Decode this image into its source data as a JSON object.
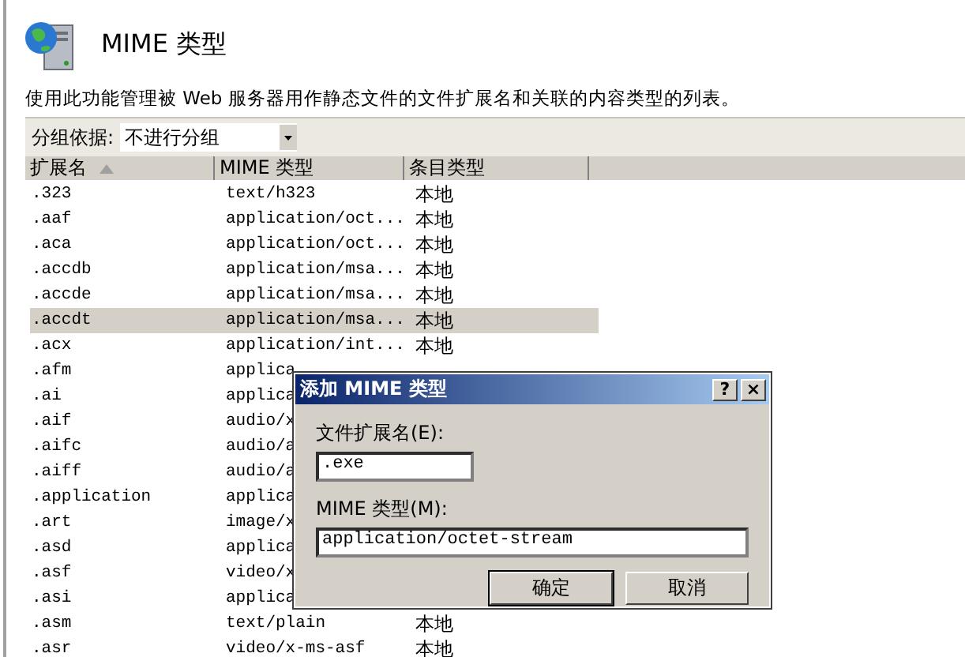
{
  "header": {
    "title": "MIME 类型",
    "description": "使用此功能管理被 Web 服务器用作静态文件的文件扩展名和关联的内容类型的列表。"
  },
  "group_by": {
    "label": "分组依据:",
    "value": "不进行分组"
  },
  "table": {
    "columns": [
      {
        "label": "扩展名",
        "sorted": true
      },
      {
        "label": "MIME 类型",
        "sorted": false
      },
      {
        "label": "条目类型",
        "sorted": false
      }
    ],
    "rows": [
      {
        "extension": ".323",
        "mime": "text/h323",
        "type": "本地",
        "selected": false
      },
      {
        "extension": ".aaf",
        "mime": "application/oct...",
        "type": "本地",
        "selected": false
      },
      {
        "extension": ".aca",
        "mime": "application/oct...",
        "type": "本地",
        "selected": false
      },
      {
        "extension": ".accdb",
        "mime": "application/msa...",
        "type": "本地",
        "selected": false
      },
      {
        "extension": ".accde",
        "mime": "application/msa...",
        "type": "本地",
        "selected": false
      },
      {
        "extension": ".accdt",
        "mime": "application/msa...",
        "type": "本地",
        "selected": true
      },
      {
        "extension": ".acx",
        "mime": "application/int...",
        "type": "本地",
        "selected": false
      },
      {
        "extension": ".afm",
        "mime": "applica",
        "selected": false
      },
      {
        "extension": ".ai",
        "mime": "applica",
        "selected": false
      },
      {
        "extension": ".aif",
        "mime": "audio/x",
        "selected": false
      },
      {
        "extension": ".aifc",
        "mime": "audio/a",
        "selected": false
      },
      {
        "extension": ".aiff",
        "mime": "audio/a",
        "selected": false
      },
      {
        "extension": ".application",
        "mime": "applica",
        "selected": false
      },
      {
        "extension": ".art",
        "mime": "image/x",
        "selected": false
      },
      {
        "extension": ".asd",
        "mime": "applica",
        "selected": false
      },
      {
        "extension": ".asf",
        "mime": "video/x",
        "selected": false
      },
      {
        "extension": ".asi",
        "mime": "applica",
        "selected": false
      },
      {
        "extension": ".asm",
        "mime": "text/plain",
        "type": "本地",
        "selected": false
      },
      {
        "extension": ".asr",
        "mime": "video/x-ms-asf",
        "type": "本地",
        "selected": false
      }
    ]
  },
  "dialog": {
    "title": "添加 MIME 类型",
    "help": "?",
    "close": "×",
    "extension_label": "文件扩展名(E):",
    "extension_value": ".exe",
    "mime_label": "MIME 类型(M):",
    "mime_value": "application/octet-stream",
    "buttons": [
      "确定",
      "取消"
    ]
  }
}
